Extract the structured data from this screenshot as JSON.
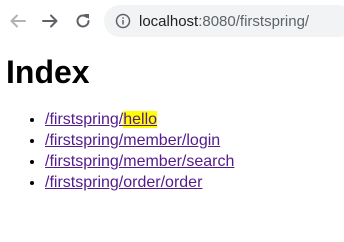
{
  "browser": {
    "url_host": "localhost",
    "url_rest": ":8080/firstspring/"
  },
  "page": {
    "title": "Index",
    "links": [
      {
        "prefix": "/firstspring/",
        "highlighted": "hello"
      },
      {
        "text": "/firstspring/member/login"
      },
      {
        "text": "/firstspring/member/search"
      },
      {
        "text": "/firstspring/order/order"
      }
    ]
  },
  "colors": {
    "link": "#551a8b",
    "highlight": "#ffff00",
    "omnibox": "#f1f3f4"
  },
  "icons": {
    "back": "arrow-left-icon",
    "forward": "arrow-right-icon",
    "reload": "reload-icon",
    "info": "info-icon"
  }
}
